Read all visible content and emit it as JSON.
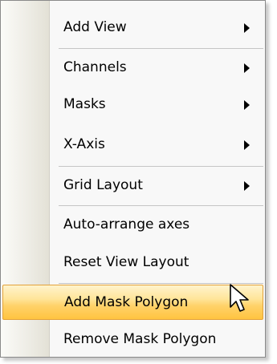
{
  "menu": {
    "items": [
      {
        "label": "Add View",
        "submenu": true
      },
      {
        "label": "Channels",
        "submenu": true
      },
      {
        "label": "Masks",
        "submenu": true
      },
      {
        "label": "X-Axis",
        "submenu": true
      },
      {
        "label": "Grid Layout",
        "submenu": true
      },
      {
        "label": "Auto-arrange axes",
        "submenu": false
      },
      {
        "label": "Reset View Layout",
        "submenu": false
      },
      {
        "label": "Add Mask Polygon",
        "submenu": false,
        "highlighted": true
      },
      {
        "label": "Remove Mask Polygon",
        "submenu": false
      }
    ]
  },
  "colors": {
    "highlight_top": "#fff3cc",
    "highlight_bottom": "#ffc440",
    "highlight_border": "#e3a23a",
    "menu_background": "#f8f8f8",
    "gutter": "#e3e1d6"
  },
  "icons": {
    "submenu": "submenu-arrow-icon",
    "cursor": "mouse-pointer-icon"
  }
}
